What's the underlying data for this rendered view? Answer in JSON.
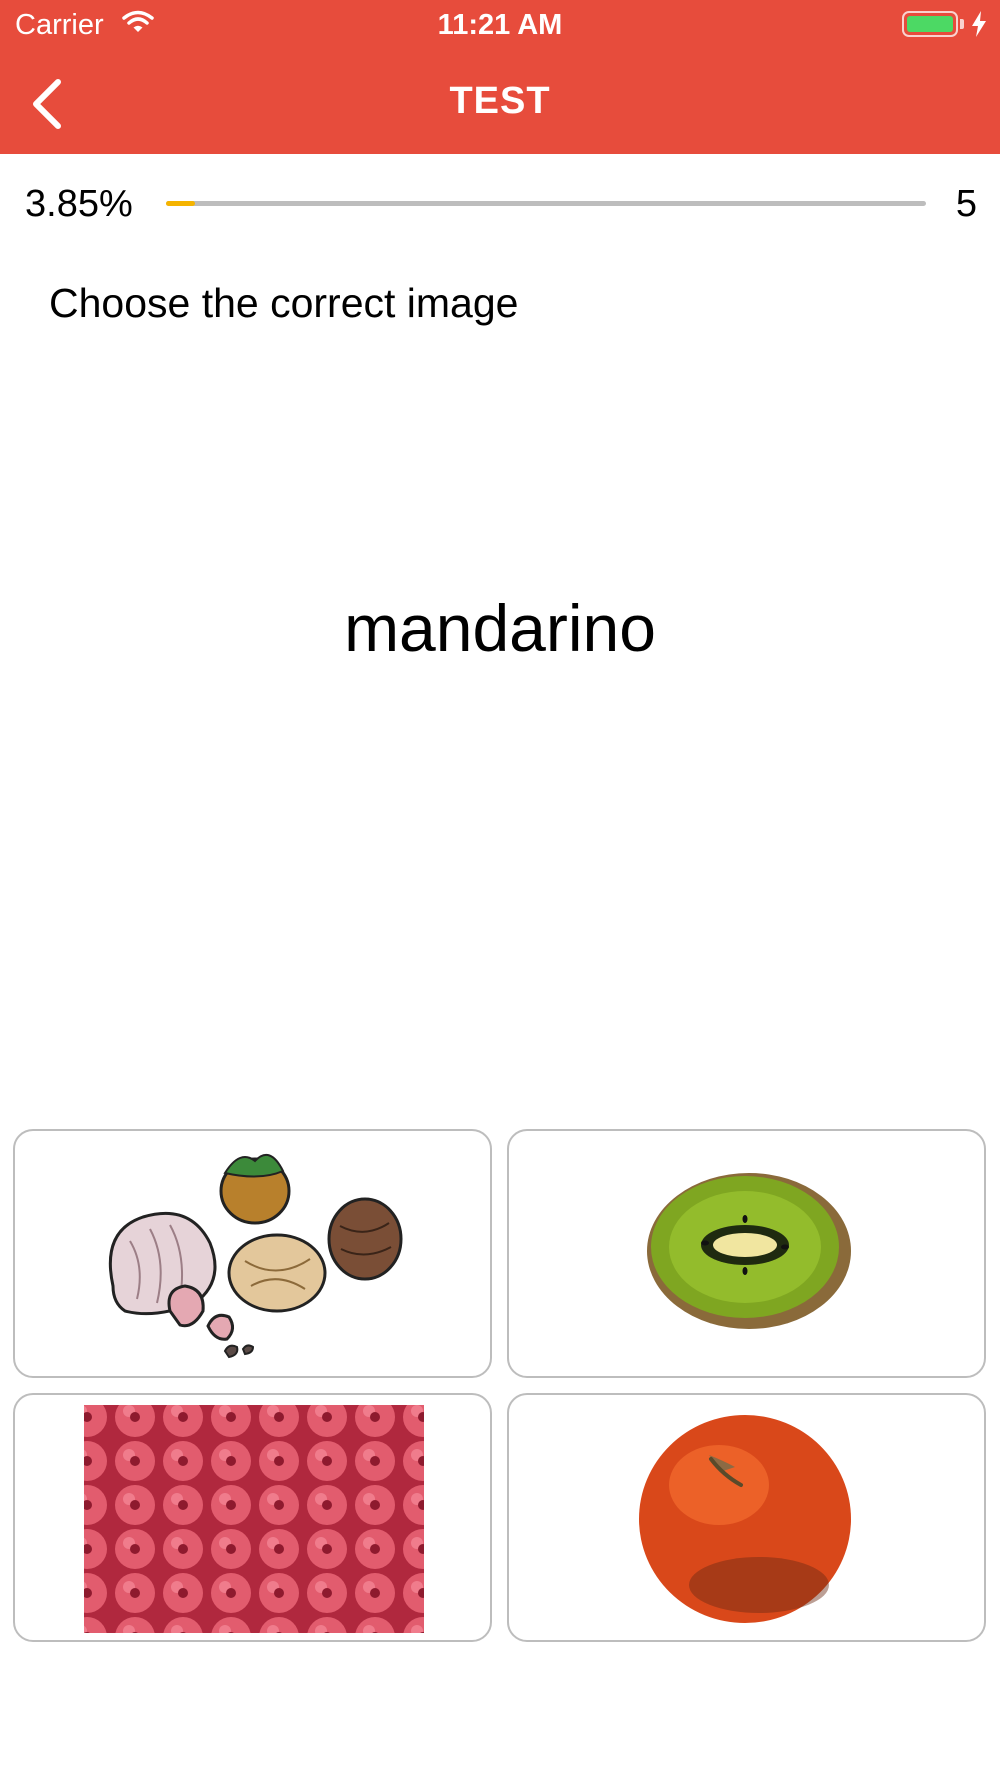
{
  "status_bar": {
    "carrier": "Carrier",
    "time": "11:21 AM",
    "battery_color": "#4CD964"
  },
  "nav": {
    "title": "TEST",
    "back_icon": "chevron-left-icon",
    "background": "#E74C3C"
  },
  "progress": {
    "percent_label": "3.85%",
    "fraction": 0.0385,
    "count": "5",
    "fill_color": "#F5B400"
  },
  "question": {
    "instruction": "Choose the correct image",
    "word": "mandarino"
  },
  "options": [
    {
      "image": "nuts-image"
    },
    {
      "image": "kiwi-image"
    },
    {
      "image": "raspberries-image"
    },
    {
      "image": "mandarin-image"
    }
  ]
}
